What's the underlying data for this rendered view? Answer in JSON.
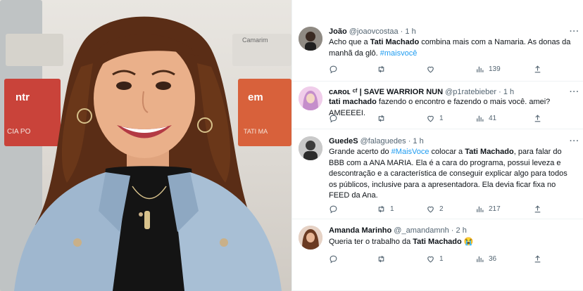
{
  "tweets": [
    {
      "name": "João",
      "handle": "@joaovcostaa",
      "time": "1 h",
      "segments": [
        {
          "text": "Acho que a ",
          "style": "normal"
        },
        {
          "text": "Tati Machado",
          "style": "bold"
        },
        {
          "text": " combina mais com a Namaria. As donas da manhã da glô. ",
          "style": "normal"
        },
        {
          "text": "#maisvocê",
          "style": "tag"
        }
      ],
      "stats": {
        "replies": "",
        "retweets": "",
        "likes": "",
        "views": "139"
      }
    },
    {
      "name": "ᴄᴀʀᴏʟ ᶜᶠ | SAVE WARRIOR NUN",
      "handle": "@p1ratebieber",
      "time": "1 h",
      "segments": [
        {
          "text": "tati machado",
          "style": "bold"
        },
        {
          "text": " fazendo o encontro e fazendo o mais você. amei? AMEEEEI.",
          "style": "normal"
        }
      ],
      "stats": {
        "replies": "",
        "retweets": "",
        "likes": "1",
        "views": "41"
      }
    },
    {
      "name": "GuedeS",
      "handle": "@falaguedes",
      "time": "1 h",
      "segments": [
        {
          "text": "Grande acerto do ",
          "style": "normal"
        },
        {
          "text": "#MaisVoce",
          "style": "tag"
        },
        {
          "text": " colocar a ",
          "style": "normal"
        },
        {
          "text": "Tati Machado",
          "style": "bold"
        },
        {
          "text": ", para falar do BBB com a ANA MARIA. Ela é a cara do programa, possui leveza e descontração e a característica de conseguir explicar algo para todos os públicos, inclusive para a apresentadora. Ela devia ficar fixa no FEED da Ana.",
          "style": "normal"
        }
      ],
      "stats": {
        "replies": "",
        "retweets": "1",
        "likes": "2",
        "views": "217"
      }
    },
    {
      "name": "Amanda Marinho",
      "handle": "@_amandamnh",
      "time": "2 h",
      "segments": [
        {
          "text": "Queria ter o trabalho da ",
          "style": "normal"
        },
        {
          "text": "Tati Machado",
          "style": "bold"
        },
        {
          "text": " 😭",
          "style": "normal"
        }
      ],
      "stats": {
        "replies": "",
        "retweets": "",
        "likes": "1",
        "views": "36"
      }
    }
  ],
  "photo_signs": {
    "left_logo": "ntr",
    "right_logo": "em",
    "left_caption": "CIA PO",
    "right_caption": "TATI MA",
    "back_sign": "Camarim"
  },
  "colors": {
    "link": "#1d9bf0",
    "text": "#0f1419",
    "muted": "#536471",
    "divider": "#eff3f4"
  },
  "icons": {
    "reply": "reply-icon",
    "retweet": "retweet-icon",
    "like": "heart-icon",
    "views": "views-icon",
    "share": "share-icon",
    "more": "more-icon"
  }
}
